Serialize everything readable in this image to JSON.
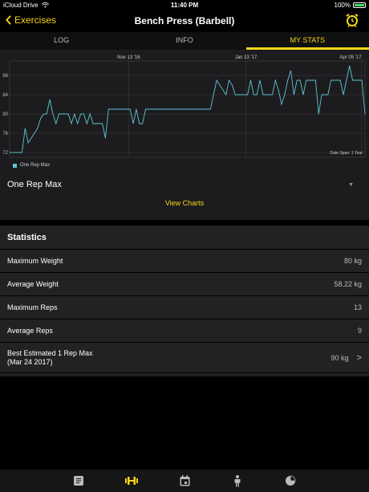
{
  "status_bar": {
    "carrier": "iCloud Drive",
    "time": "11:40 PM",
    "battery": "100%"
  },
  "nav": {
    "back_label": "Exercises",
    "title": "Bench Press (Barbell)"
  },
  "tabs": [
    {
      "label": "LOG",
      "active": false
    },
    {
      "label": "INFO",
      "active": false
    },
    {
      "label": "MY STATS",
      "active": true
    }
  ],
  "chart_data": {
    "type": "line",
    "x_tick_labels": [
      "Nov 13 '16",
      "Jan 23 '17",
      "Apr 05 '17"
    ],
    "y_tick_labels": [
      "72",
      "76",
      "80",
      "84",
      "88"
    ],
    "ylim": [
      71,
      91
    ],
    "annotation": "Date Span: 1 Year",
    "series": [
      {
        "name": "One Rep Max",
        "color": "#5fc4d6",
        "values": [
          72,
          72,
          72,
          72,
          72,
          77,
          74,
          75,
          76,
          77,
          79,
          80,
          80,
          83,
          80,
          78,
          80,
          80,
          80,
          80,
          78,
          80,
          78,
          80,
          80,
          78,
          80,
          78,
          78,
          78,
          78,
          75,
          81,
          81,
          81,
          81,
          81,
          81,
          81,
          81,
          78,
          81,
          78,
          78,
          81,
          81,
          81,
          81,
          81,
          81,
          81,
          81,
          81,
          81,
          81,
          81,
          81,
          81,
          81,
          81,
          81,
          81,
          81,
          81,
          81,
          81,
          84,
          87,
          86,
          85,
          84,
          87,
          86,
          84,
          84,
          84,
          84,
          84,
          87,
          84,
          84,
          87,
          84,
          84,
          84,
          84,
          87,
          85,
          82,
          84,
          87,
          89,
          84,
          87,
          87,
          84,
          87,
          87,
          87,
          87,
          80,
          84,
          84,
          84,
          87,
          87,
          87,
          87,
          84,
          87,
          90,
          87,
          87,
          87,
          87,
          80
        ]
      }
    ]
  },
  "legend_label": "One Rep Max",
  "metric_selector": {
    "label": "One Rep Max"
  },
  "view_charts_label": "View Charts",
  "statistics": {
    "title": "Statistics",
    "rows": [
      {
        "label": "Maximum Weight",
        "value": "80 kg"
      },
      {
        "label": "Average Weight",
        "value": "58.22 kg"
      },
      {
        "label": "Maximum Reps",
        "value": "13"
      },
      {
        "label": "Average Reps",
        "value": "9"
      }
    ],
    "best": {
      "label_line1": "Best Estimated 1 Rep Max",
      "label_line2": "(Mar 24 2017)",
      "value": "90 kg"
    }
  },
  "colors": {
    "accent": "#f5d617",
    "line": "#5fc4d6"
  }
}
